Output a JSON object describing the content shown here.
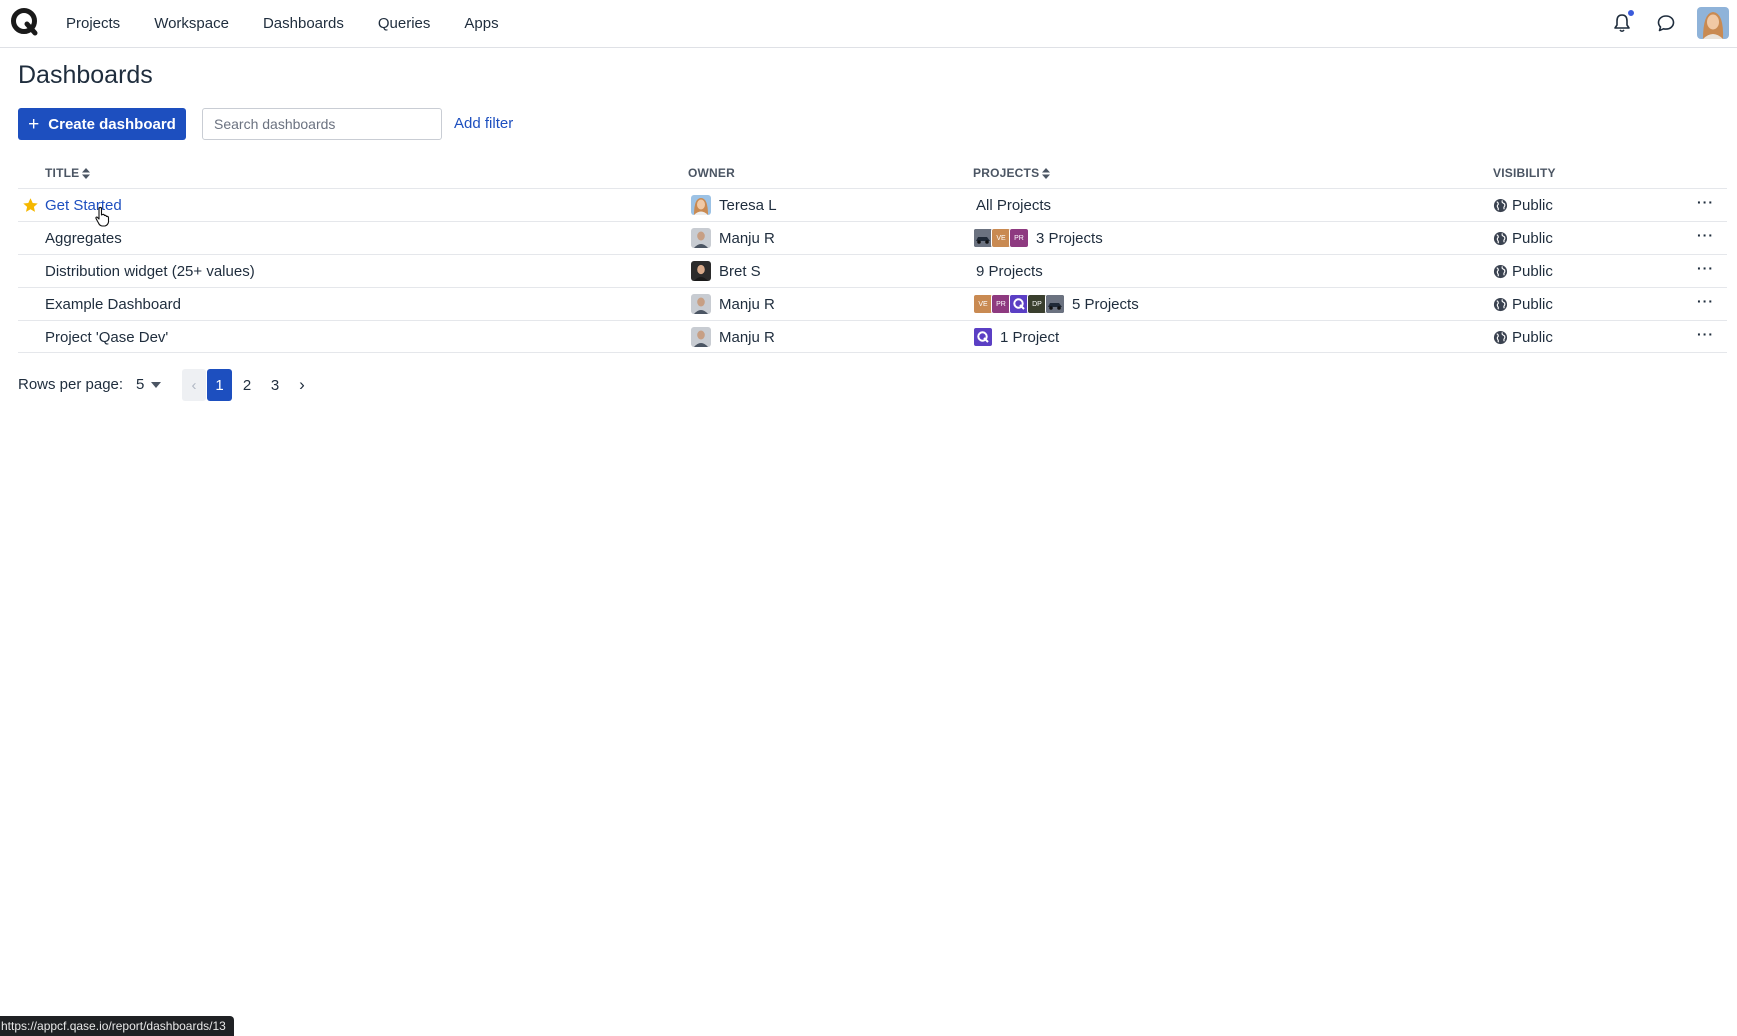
{
  "nav": {
    "logo_icon": "qase-logo-icon",
    "items": [
      {
        "label": "Projects"
      },
      {
        "label": "Workspace"
      },
      {
        "label": "Dashboards"
      },
      {
        "label": "Queries"
      },
      {
        "label": "Apps"
      }
    ],
    "notification_icon": "bell-icon",
    "chat_icon": "chat-bubble-icon"
  },
  "page": {
    "title": "Dashboards",
    "create_label": "Create dashboard",
    "search_placeholder": "Search dashboards",
    "add_filter_label": "Add filter"
  },
  "table": {
    "headers": {
      "title": "TITLE",
      "owner": "OWNER",
      "projects": "PROJECTS",
      "visibility": "VISIBILITY"
    },
    "rows": [
      {
        "title": "Get Started",
        "starred": true,
        "owner": "Teresa L",
        "projects": "All Projects",
        "project_avatars": [],
        "visibility": "Public"
      },
      {
        "title": "Aggregates",
        "starred": false,
        "owner": "Manju R",
        "projects": "3 Projects",
        "project_avatars": [
          "car",
          "VE",
          "PR"
        ],
        "visibility": "Public"
      },
      {
        "title": "Distribution widget (25+ values)",
        "starred": false,
        "owner": "Bret S",
        "projects": "9 Projects",
        "project_avatars": [],
        "visibility": "Public"
      },
      {
        "title": "Example Dashboard",
        "starred": false,
        "owner": "Manju R",
        "projects": "5 Projects",
        "project_avatars": [
          "VE",
          "PR",
          "Q",
          "DP",
          "car"
        ],
        "visibility": "Public"
      },
      {
        "title": "Project 'Qase Dev'",
        "starred": false,
        "owner": "Manju R",
        "projects": "1 Project",
        "project_avatars": [
          "Q"
        ],
        "visibility": "Public"
      }
    ]
  },
  "pagination": {
    "rows_label": "Rows per page:",
    "rows_value": "5",
    "prev": "‹",
    "pages": [
      "1",
      "2",
      "3"
    ],
    "current_page": "1",
    "next": "›"
  },
  "status_url": "https://appcf.qase.io/report/dashboards/13",
  "colors": {
    "primary": "#1d4fbf",
    "text": "#1f2d3d",
    "star": "#f5b800",
    "notification_dot": "#3b5bdb"
  }
}
